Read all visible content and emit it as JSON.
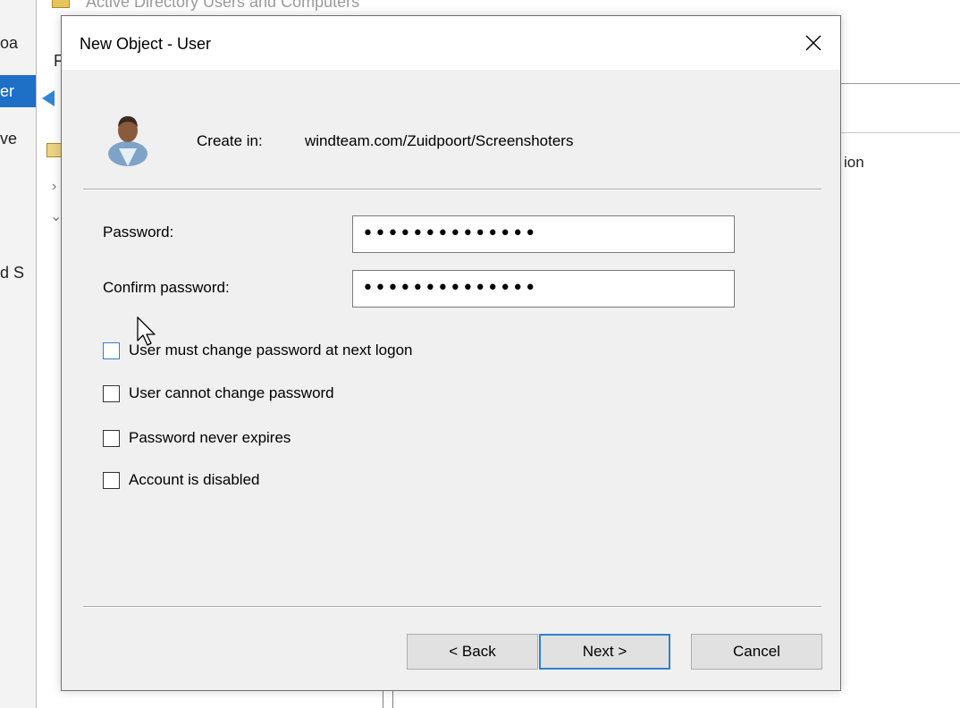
{
  "background_window": {
    "title": "Active Directory Users and Computers",
    "left_fragments": [
      "oa",
      "er",
      "ve",
      "d S"
    ],
    "menu_fragment": "F",
    "column_fragment": "ion"
  },
  "dialog": {
    "title": "New Object - User",
    "create_in_label": "Create in:",
    "create_in_path": "windteam.com/Zuidpoort/Screenshoters",
    "password_label": "Password:",
    "password_value": "••••••••••••••",
    "confirm_label": "Confirm password:",
    "confirm_value": "••••••••••••••",
    "checkboxes": [
      {
        "label": "User must change password at next logon",
        "checked": false
      },
      {
        "label": "User cannot change password",
        "checked": false
      },
      {
        "label": "Password never expires",
        "checked": false
      },
      {
        "label": "Account is disabled",
        "checked": false
      }
    ],
    "buttons": {
      "back": "< Back",
      "next": "Next >",
      "cancel": "Cancel"
    }
  },
  "colors": {
    "accent": "#2f7fd0",
    "dialog_bg": "#f0f0f0",
    "selection": "#1e6fc6"
  },
  "icons": [
    "user-icon",
    "close-icon",
    "folder-icon",
    "back-arrow-icon",
    "mouse-pointer-icon"
  ]
}
